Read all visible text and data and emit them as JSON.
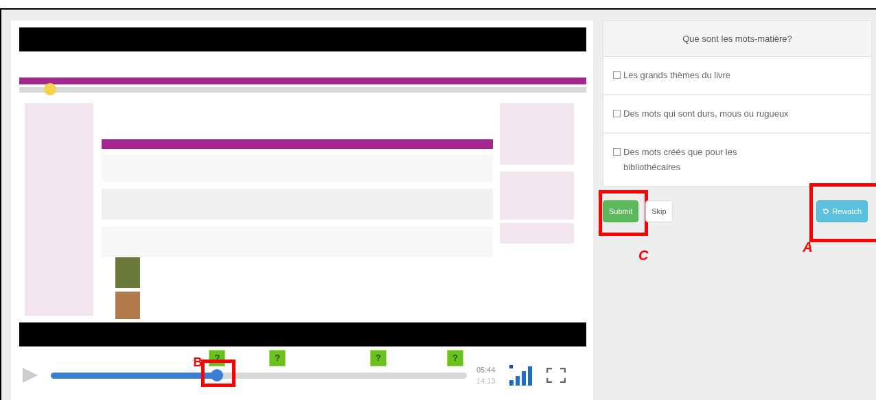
{
  "player": {
    "playing": false,
    "level": 0.4,
    "annotation": "B",
    "elapsed": "05:44",
    "duration": "14:13",
    "markers": [
      {
        "text": "?"
      },
      {
        "text": "?"
      },
      {
        "text": "?"
      },
      {
        "text": "?"
      }
    ]
  },
  "question": {
    "title": "Que sont les mots-matière?",
    "options": [
      {
        "label": "Les grands thèmes du livre",
        "checked": false
      },
      {
        "label": "Des mots qui sont durs, mous ou rugueux",
        "checked": false
      },
      {
        "label": "Des mots créés que pour les bibliothécaires",
        "checked": false
      }
    ]
  },
  "buttons": [
    {
      "kind": "submit",
      "label": "Submit",
      "annotation": "C"
    },
    {
      "kind": "skip",
      "label": "Skip"
    },
    {
      "kind": "rewatch",
      "label": "Rewatch",
      "annotation": "A"
    }
  ]
}
